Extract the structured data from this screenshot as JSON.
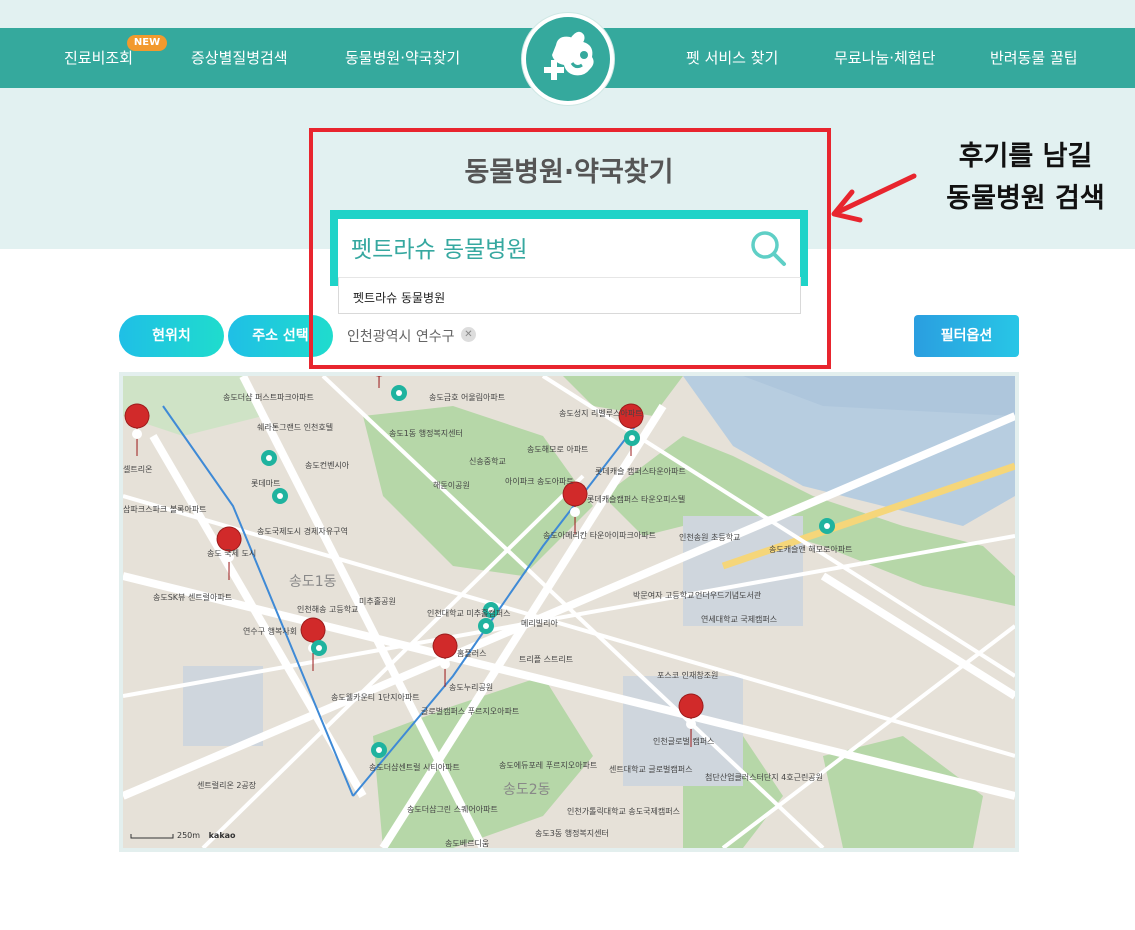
{
  "nav": {
    "items": [
      {
        "label": "진료비조회"
      },
      {
        "label": "증상별질병검색"
      },
      {
        "label": "동물병원·약국찾기"
      },
      {
        "label": "펫 서비스 찾기"
      },
      {
        "label": "무료나눔·체험단"
      },
      {
        "label": "반려동물 꿀팁"
      }
    ],
    "new_badge": "NEW"
  },
  "hero": {
    "title": "동물병원·약국찾기",
    "search_value": "펫트라슈 동물병원",
    "suggestion": "펫트라슈 동물병원"
  },
  "controls": {
    "location_button": "현위치",
    "address_button": "주소 선택",
    "selected_address": "인천광역시 연수구",
    "filter_button": "필터옵션"
  },
  "annotation": {
    "line1": "후기를 남길",
    "line2": "동물병원 검색"
  },
  "map": {
    "provider": "kakao",
    "scale": "250m",
    "labels": [
      {
        "text": "송도금호 어울림아파트"
      },
      {
        "text": "송도성지 리벨루스아파트"
      },
      {
        "text": "쉐라톤그랜드 인천호텔"
      },
      {
        "text": "송도1동 행정복지센터"
      },
      {
        "text": "송도해모로 아파트"
      },
      {
        "text": "신송중학교"
      },
      {
        "text": "롯데캐슬 캠퍼스타운아파트"
      },
      {
        "text": "송도컨벤시아"
      },
      {
        "text": "해돋이공원"
      },
      {
        "text": "아이파크 송도아파트"
      },
      {
        "text": "롯데마트"
      },
      {
        "text": "롯데캐슬캠퍼스 타운오피스텔"
      },
      {
        "text": "송도국제도시 경제자유구역"
      },
      {
        "text": "송도아메리칸 타운아이파크아파트"
      },
      {
        "text": "인천송원 초등학교"
      },
      {
        "text": "송도캐슬앤 해모로아파트"
      },
      {
        "text": "송도SK뷰 센트럴아파트"
      },
      {
        "text": "송도1동"
      },
      {
        "text": "미추홀공원"
      },
      {
        "text": "인천해송 고등학교"
      },
      {
        "text": "인천대학교 미추홀캠퍼스"
      },
      {
        "text": "메리빌리아"
      },
      {
        "text": "박문여자 고등학교"
      },
      {
        "text": "언더우드기념도서관"
      },
      {
        "text": "연세대학교 국제캠퍼스"
      },
      {
        "text": "홈플러스"
      },
      {
        "text": "트리플 스트리트"
      },
      {
        "text": "포스코 인재창조원"
      },
      {
        "text": "송도웰카운티 1단지아파트"
      },
      {
        "text": "송도누리공원"
      },
      {
        "text": "글로벌캠퍼스 푸르지오아파트"
      },
      {
        "text": "인천글로벌 캠퍼스"
      },
      {
        "text": "송도에듀포레 푸르지오아파트"
      },
      {
        "text": "센트럴리온 2공장"
      },
      {
        "text": "송도더샵센트럴 시티아파트"
      },
      {
        "text": "센트대학교 글로벌캠퍼스"
      },
      {
        "text": "첨단산업클러스터단지 4호근린공원"
      },
      {
        "text": "송도2동"
      },
      {
        "text": "송도더샵그린 스퀘어아파트"
      },
      {
        "text": "인천가톨릭대학교 송도국제캠퍼스"
      },
      {
        "text": "송도3동 행정복지센터"
      },
      {
        "text": "송도베르디움"
      },
      {
        "text": "삽파크스파크 볼록아파트"
      },
      {
        "text": "송도 국제 도시"
      },
      {
        "text": "송도더샵 퍼스트파크아파트"
      },
      {
        "text": "연수구 행복사회"
      },
      {
        "text": "셀트리온"
      }
    ]
  }
}
